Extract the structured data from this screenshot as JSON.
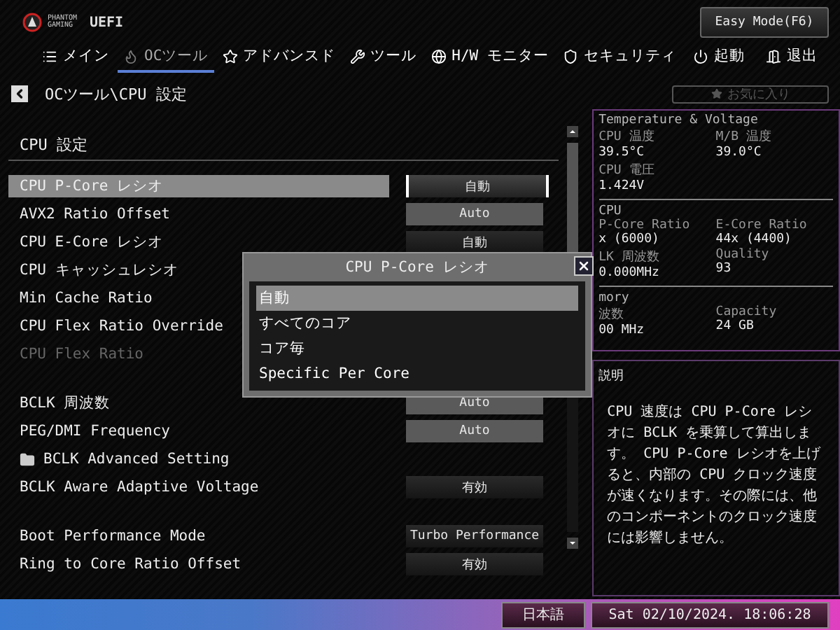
{
  "header": {
    "brand": "PHANTOM GAMING",
    "product": "UEFI",
    "mode_button": "Easy Mode(F6)"
  },
  "tabs": [
    {
      "label": "メイン",
      "selected": false
    },
    {
      "label": "OCツール",
      "selected": true
    },
    {
      "label": "アドバンスド",
      "selected": false
    },
    {
      "label": "ツール",
      "selected": false
    },
    {
      "label": "H/W モニター",
      "selected": false
    },
    {
      "label": "セキュリティ",
      "selected": false
    },
    {
      "label": "起動",
      "selected": false
    },
    {
      "label": "退出",
      "selected": false
    }
  ],
  "breadcrumb": "OCツール\\CPU 設定",
  "favorites": "お気に入り",
  "section_title": "CPU 設定",
  "groups": [
    [
      {
        "label": "CPU P-Core レシオ",
        "value": "自動",
        "selected": true,
        "disabled": false,
        "kind": "setting"
      },
      {
        "label": "AVX2 Ratio Offset",
        "value": "Auto",
        "selected": false,
        "disabled": false,
        "kind": "setting"
      },
      {
        "label": "CPU E-Core レシオ",
        "value": "自動",
        "selected": false,
        "disabled": false,
        "kind": "setting"
      },
      {
        "label": "CPU  キャッシュレシオ",
        "selected": false,
        "disabled": false,
        "kind": "setting"
      },
      {
        "label": "Min Cache  Ratio",
        "selected": false,
        "disabled": false,
        "kind": "setting"
      },
      {
        "label": "CPU Flex   Ratio Override",
        "selected": false,
        "disabled": false,
        "kind": "setting"
      },
      {
        "label": "CPU Flex   Ratio",
        "selected": false,
        "disabled": true,
        "kind": "setting"
      }
    ],
    [
      {
        "label": "BCLK 周波数",
        "value": "Auto",
        "selected": false,
        "disabled": false,
        "kind": "setting"
      },
      {
        "label": "PEG/DMI Frequency",
        "value": "Auto",
        "selected": false,
        "disabled": false,
        "kind": "setting"
      },
      {
        "label": "BCLK Advanced Setting",
        "selected": false,
        "disabled": false,
        "kind": "folder"
      },
      {
        "label": "BCLK Aware Adaptive Voltage",
        "value": "有効",
        "selected": false,
        "disabled": false,
        "kind": "setting"
      }
    ],
    [
      {
        "label": "Boot Performance Mode",
        "value": "Turbo Performance",
        "selected": false,
        "disabled": false,
        "kind": "setting"
      },
      {
        "label": "Ring to Core Ratio Offset",
        "value": "有効",
        "selected": false,
        "disabled": false,
        "kind": "setting"
      }
    ]
  ],
  "monitor": [
    {
      "title": "Temperature & Voltage",
      "items": [
        {
          "label": "CPU 温度",
          "value": "39.5°C"
        },
        {
          "label": "M/B 温度",
          "value": "39.0°C"
        },
        {
          "label": "CPU 電圧",
          "value": "1.424V"
        }
      ]
    },
    {
      "title": "CPU",
      "items": [
        {
          "label": "P-Core Ratio",
          "value": "x (6000)"
        },
        {
          "label": "E-Core Ratio",
          "value": "44x (4400)"
        },
        {
          "label": "LK 周波数",
          "value": "0.000MHz"
        },
        {
          "label": "Quality",
          "value": "93"
        }
      ]
    },
    {
      "title": "mory",
      "items": [
        {
          "label": "波数",
          "value": "00 MHz"
        },
        {
          "label": "Capacity",
          "value": "24 GB"
        }
      ]
    }
  ],
  "description": {
    "title": "説明",
    "text": "CPU 速度は CPU P-Core レシオに BCLK を乗算して算出します。 CPU P-Core レシオを上げると、内部の CPU クロック速度が速くなります。その際には、他のコンポーネントのクロック速度には影響しません。"
  },
  "footer": {
    "language": "日本語",
    "datetime": "Sat 02/10/2024. 18:06:28"
  },
  "dialog": {
    "title": "CPU P-Core レシオ",
    "options": [
      {
        "label": "自動",
        "selected": true
      },
      {
        "label": "すべてのコア",
        "selected": false
      },
      {
        "label": "コア毎",
        "selected": false
      },
      {
        "label": "Specific Per Core",
        "selected": false
      }
    ]
  }
}
